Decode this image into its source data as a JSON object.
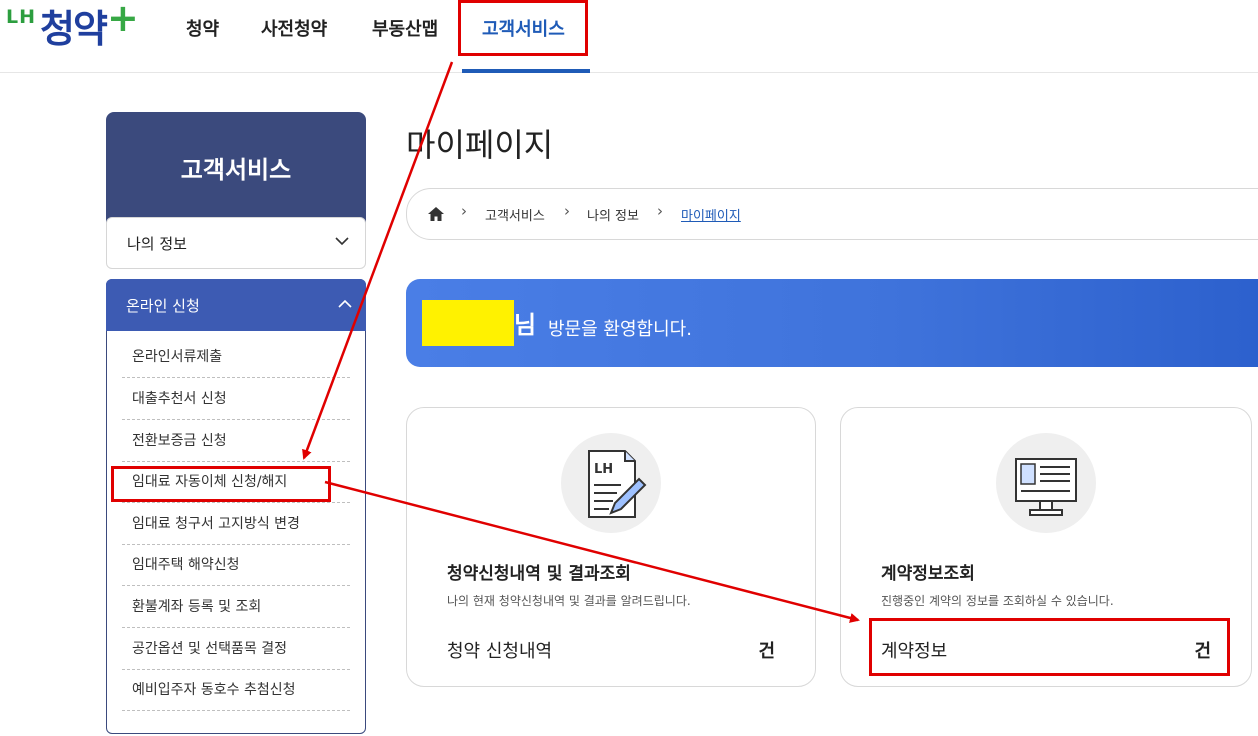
{
  "logo": {
    "lh": "LH",
    "main": "청약",
    "plus": "+"
  },
  "nav": {
    "items": [
      "청약",
      "사전청약",
      "부동산맵",
      "고객서비스"
    ],
    "active_index": 3
  },
  "sidebar": {
    "title": "고객서비스",
    "select_label": "나의 정보",
    "section_label": "온라인 신청",
    "items": [
      "온라인서류제출",
      "대출추천서 신청",
      "전환보증금 신청",
      "임대료 자동이체 신청/해지",
      "임대료 청구서 고지방식 변경",
      "임대주택 해약신청",
      "환불계좌 등록 및 조회",
      "공간옵션 및 선택품목 결정",
      "예비입주자 동호수 추첨신청"
    ]
  },
  "main": {
    "page_title": "마이페이지",
    "breadcrumb": [
      "고객서비스",
      "나의 정보",
      "마이페이지"
    ],
    "welcome": {
      "suffix": "님",
      "text": "방문을 환영합니다."
    },
    "cards": [
      {
        "icon": "document-pen-icon",
        "title": "청약신청내역 및 결과조회",
        "desc": "나의 현재 청약신청내역 및 결과를 알려드립니다.",
        "label": "청약 신청내역",
        "count": "건"
      },
      {
        "icon": "monitor-icon",
        "title": "계약정보조회",
        "desc": "진행중인 계약의 정보를 조회하실 수 있습니다.",
        "label": "계약정보",
        "count": "건"
      }
    ]
  },
  "colors": {
    "brand_blue": "#1f5bb7",
    "sidebar_dark": "#3b4a7d",
    "section_blue": "#3d5bb3",
    "highlight_red": "#e00000",
    "redaction_yellow": "#fff200"
  }
}
